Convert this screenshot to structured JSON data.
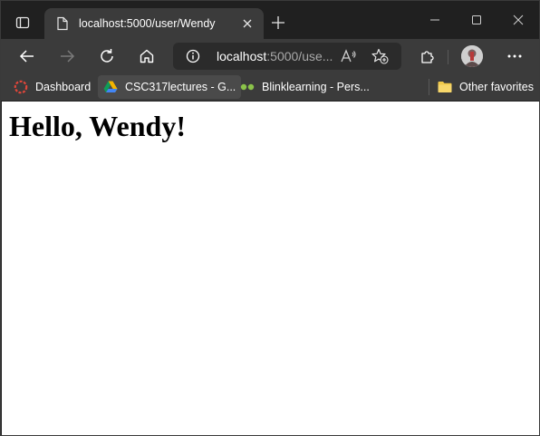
{
  "tab": {
    "title": "localhost:5000/user/Wendy"
  },
  "address": {
    "host": "localhost",
    "path": ":5000/use..."
  },
  "favorites": [
    {
      "label": "Dashboard",
      "icon": "dashboard-ring-icon"
    },
    {
      "label": "CSC317lectures - G...",
      "icon": "google-drive-icon"
    },
    {
      "label": "Blinklearning - Pers...",
      "icon": "blinklearning-icon"
    },
    {
      "label": "Other favorites",
      "icon": "folder-icon"
    }
  ],
  "page": {
    "heading": "Hello, Wendy!"
  },
  "icons": {
    "read_aloud": "A⁾",
    "read_aloud_name": "read-aloud-icon"
  },
  "colors": {
    "chrome_dark": "#202020",
    "toolbar": "#3b3b3b",
    "address_bg": "#2b2b2b",
    "content_bg": "#ffffff"
  }
}
